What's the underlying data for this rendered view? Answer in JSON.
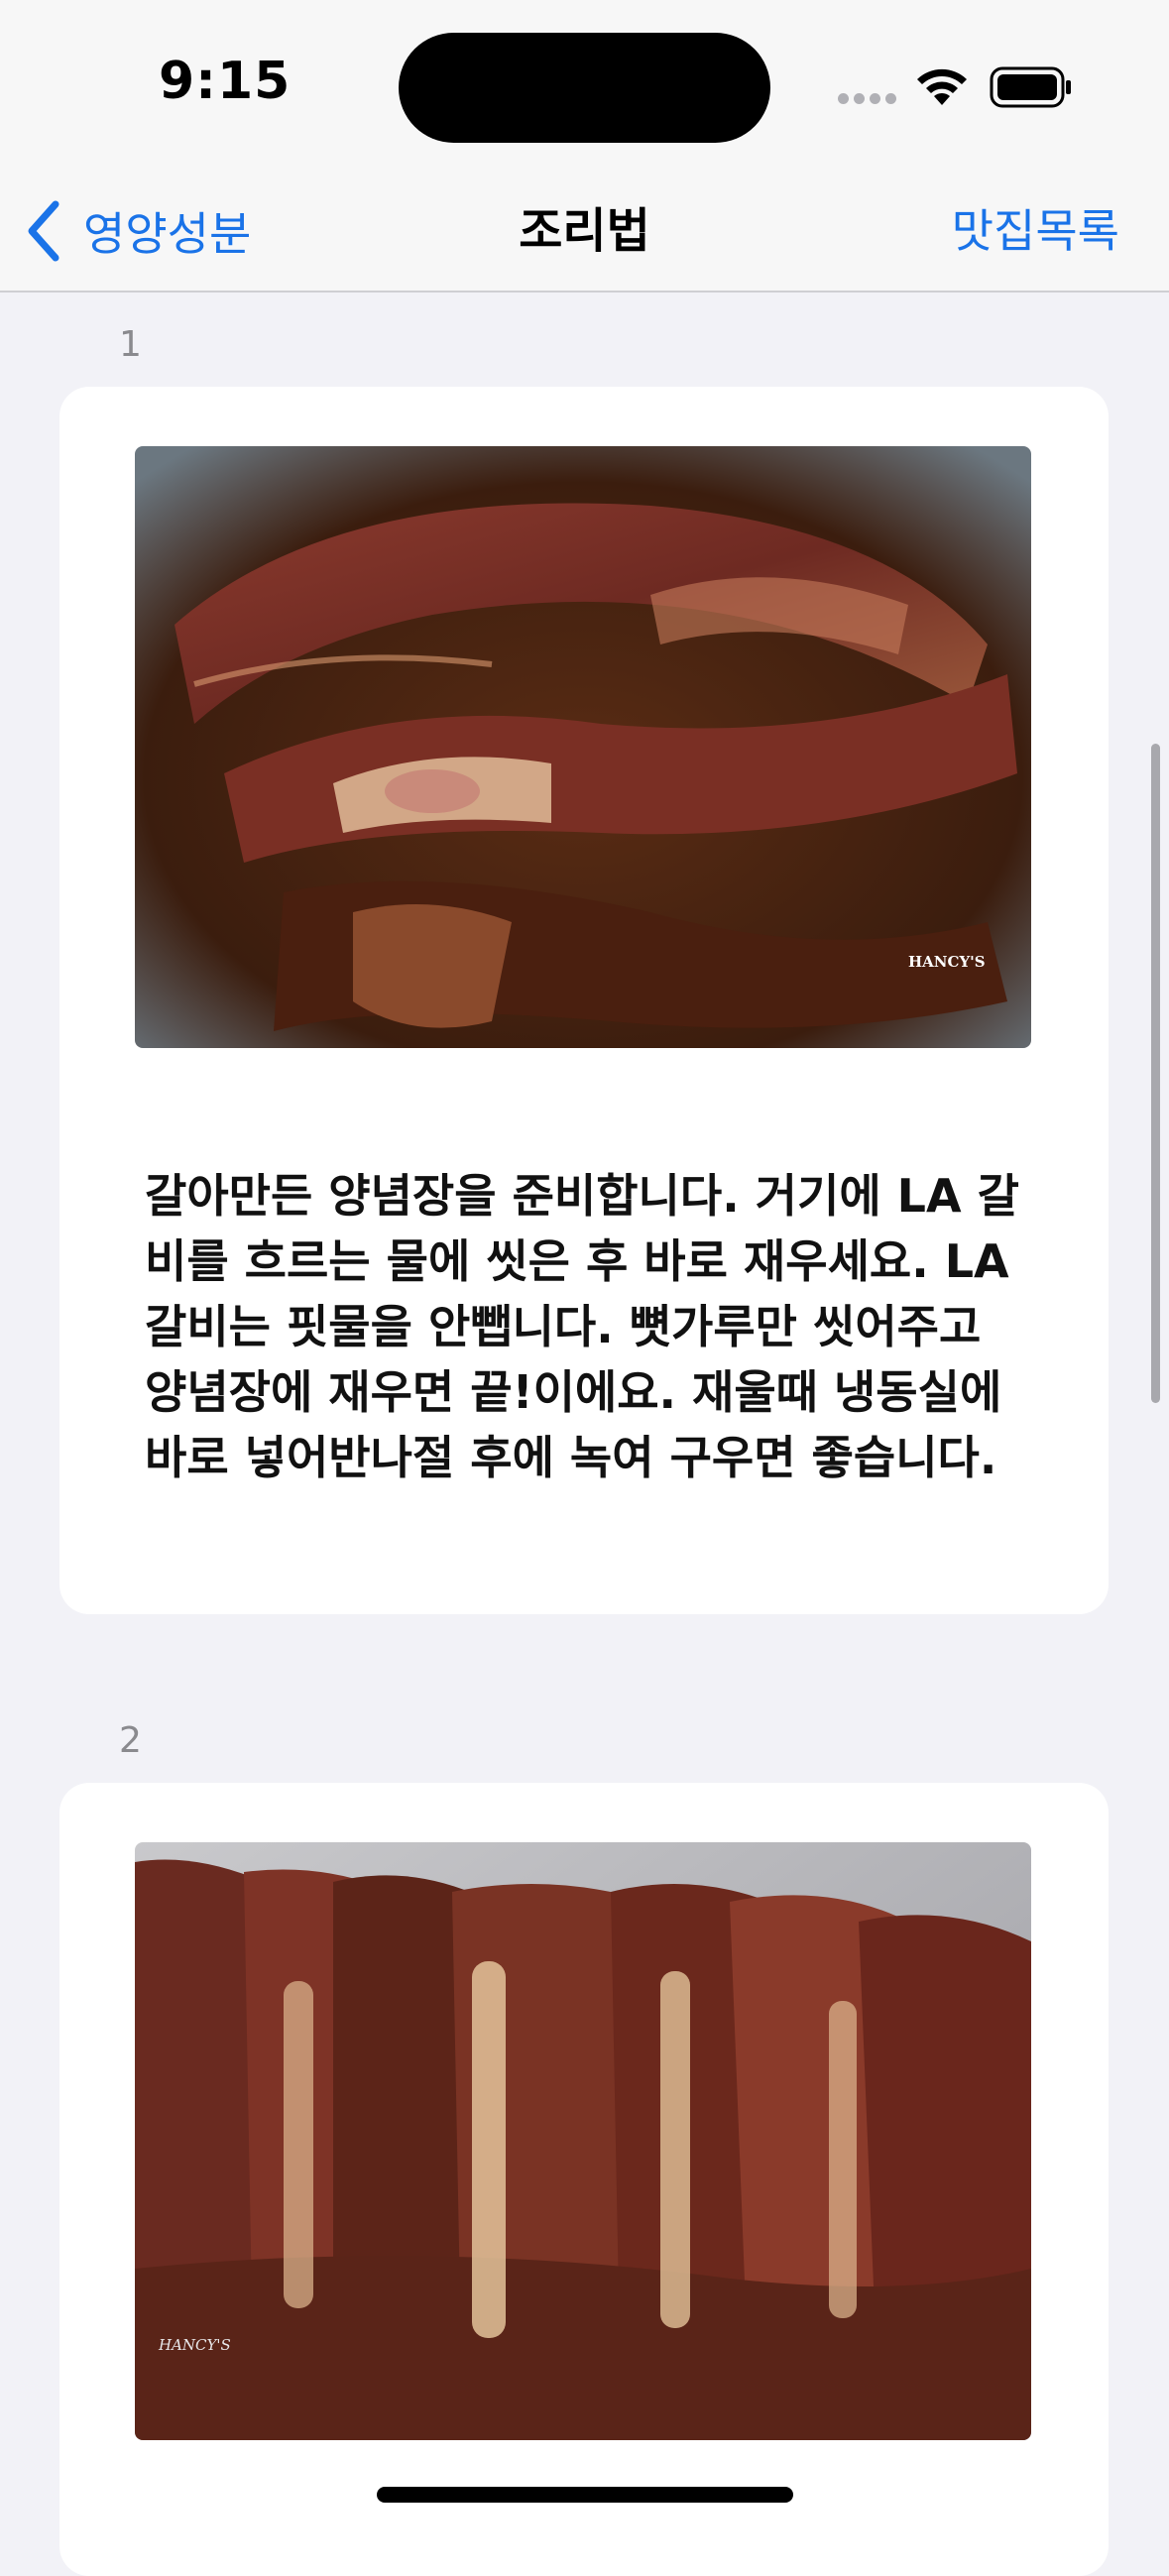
{
  "status_bar": {
    "time": "9:15"
  },
  "nav": {
    "back_label": "영양성분",
    "title": "조리법",
    "right_label": "맛집목록"
  },
  "steps": [
    {
      "number": "1",
      "image_icon": "marinated-ribs-in-bowl-photo",
      "watermark": "HANCY'S",
      "text": "갈아만든 양념장을 준비합니다. 거기에 LA 갈비를 흐르는 물에 씻은 후 바로 재우세요. LA갈비는 핏물을 안뺍니다. 뼛가루만 씻어주고 양념장에 재우면 끝!이에요. 재울때 냉동실에 바로 넣어반나절 후에 녹여 구우면 좋습니다."
    },
    {
      "number": "2",
      "image_icon": "ribs-on-foil-photo",
      "watermark": "HANCY'S"
    }
  ],
  "colors": {
    "accent": "#1a73e8",
    "background": "#f2f2f7",
    "card": "#ffffff"
  }
}
